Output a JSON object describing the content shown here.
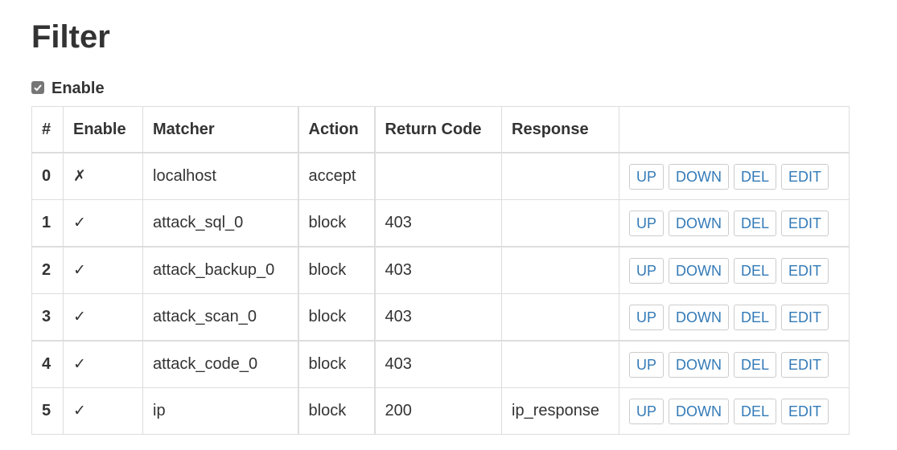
{
  "title": "Filter",
  "enable": {
    "label": "Enable",
    "checked": true
  },
  "table": {
    "headers": [
      "#",
      "Enable",
      "Matcher",
      "Action",
      "Return Code",
      "Response",
      ""
    ],
    "rows": [
      {
        "index": "0",
        "enabled": "✗",
        "matcher": "localhost",
        "action": "accept",
        "return_code": "",
        "response": ""
      },
      {
        "index": "1",
        "enabled": "✓",
        "matcher": "attack_sql_0",
        "action": "block",
        "return_code": "403",
        "response": ""
      },
      {
        "index": "2",
        "enabled": "✓",
        "matcher": "attack_backup_0",
        "action": "block",
        "return_code": "403",
        "response": ""
      },
      {
        "index": "3",
        "enabled": "✓",
        "matcher": "attack_scan_0",
        "action": "block",
        "return_code": "403",
        "response": ""
      },
      {
        "index": "4",
        "enabled": "✓",
        "matcher": "attack_code_0",
        "action": "block",
        "return_code": "403",
        "response": ""
      },
      {
        "index": "5",
        "enabled": "✓",
        "matcher": "ip",
        "action": "block",
        "return_code": "200",
        "response": "ip_response"
      }
    ],
    "buttons": {
      "up": "UP",
      "down": "DOWN",
      "del": "DEL",
      "edit": "EDIT"
    }
  },
  "colors": {
    "link": "#337ab7",
    "border": "#dddddd",
    "text": "#333333"
  }
}
